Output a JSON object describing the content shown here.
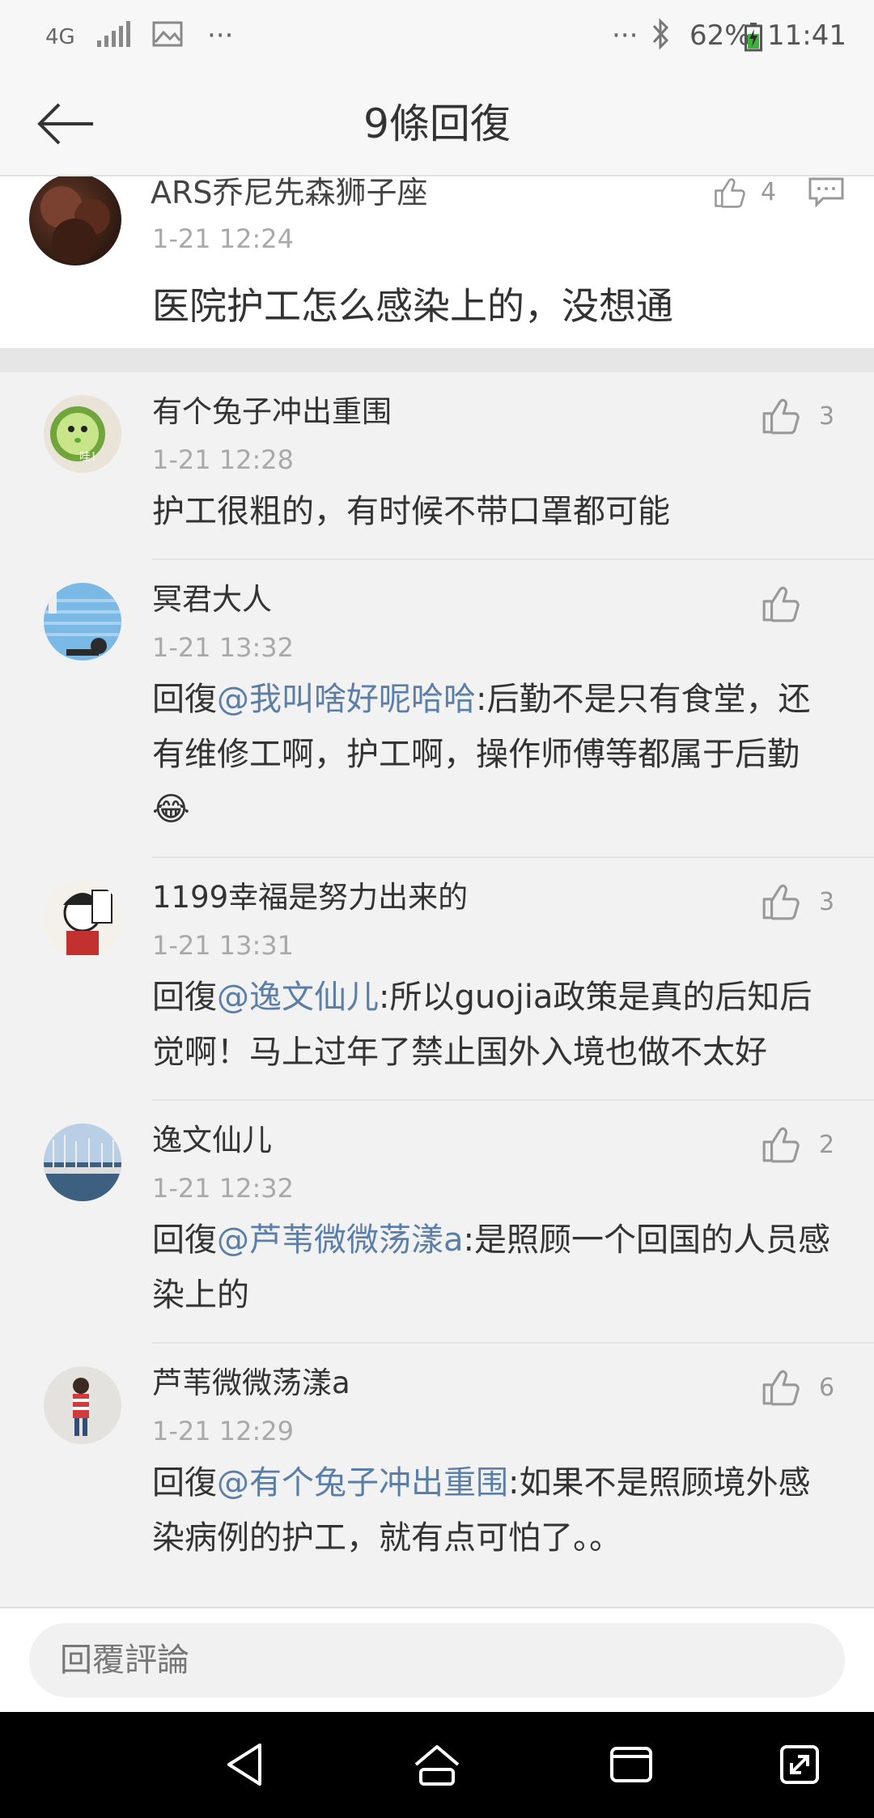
{
  "status_bar": {
    "network": "4G",
    "battery_percent": "62%",
    "time": "11:41",
    "more_left": "···",
    "more_right": "···"
  },
  "header": {
    "title": "9條回復"
  },
  "main_comment": {
    "username": "ARS乔尼先森狮子座",
    "time": "1-21 12:24",
    "content": "医院护工怎么感染上的，没想通",
    "likes": "4"
  },
  "replies": [
    {
      "username": "有个兔子冲出重围",
      "time": "1-21 12:28",
      "reply_prefix": "",
      "mention": "",
      "text": "护工很粗的，有时候不带口罩都可能",
      "likes": "3"
    },
    {
      "username": "冥君大人",
      "time": "1-21 13:32",
      "reply_prefix": "回復",
      "mention": "@我叫啥好呢哈哈",
      "text": ":后勤不是只有食堂，还有维修工啊，护工啊，操作师傅等都属于后勤😂",
      "likes": ""
    },
    {
      "username": "1199幸福是努力出来的",
      "time": "1-21 13:31",
      "reply_prefix": "回復",
      "mention": "@逸文仙儿",
      "text": ":所以guojia政策是真的后知后觉啊！马上过年了禁止国外入境也做不太好",
      "likes": "3"
    },
    {
      "username": "逸文仙儿",
      "time": "1-21 12:32",
      "reply_prefix": "回復",
      "mention": "@芦苇微微荡漾a",
      "text": ":是照顾一个回国的人员感染上的",
      "likes": "2"
    },
    {
      "username": "芦苇微微荡漾a",
      "time": "1-21 12:29",
      "reply_prefix": "回復",
      "mention": "@有个兔子冲出重围",
      "text": ":如果不是照顾境外感染病例的护工，就有点可怕了。。",
      "likes": "6"
    }
  ],
  "bottom": {
    "placeholder": "回覆評論"
  },
  "avatar_text": {
    "cucumber": "哇！"
  }
}
